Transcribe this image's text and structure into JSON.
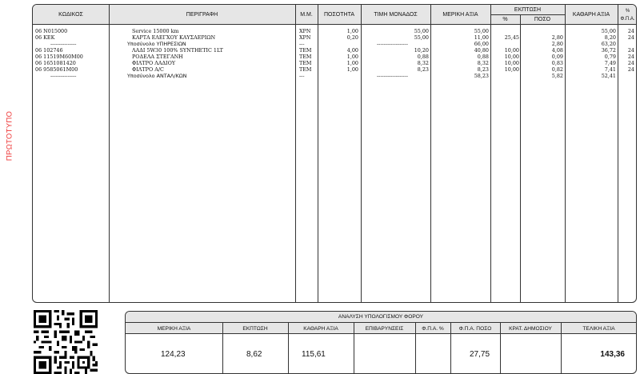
{
  "stamp_text": "ΠΡΩΤΟΤΥΠΟ",
  "columns": {
    "code": "ΚΩΔΙΚΟΣ",
    "description": "ΠΕΡΙΓΡΑΦΗ",
    "unit": "Μ.Μ.",
    "quantity": "ΠΟΣΟΤΗΤΑ",
    "unit_price": "ΤΙΜΗ ΜΟΝΑΔΟΣ",
    "partial_value": "ΜΕΡΙΚΗ ΑΞΙΑ",
    "discount": "ΕΚΠΤΩΣΗ",
    "discount_pct": "%",
    "discount_amount": "ΠΟΣΟ",
    "net_value": "ΚΑΘΑΡΗ ΑΞΙΑ",
    "vat_pct_top": "%",
    "vat_pct_bottom": "Φ.Π.Α."
  },
  "rows": [
    {
      "code": "06 N015000",
      "desc": "Service 15000 km",
      "unit": "ΧΡΝ",
      "qty": "1,00",
      "price": "55,00",
      "partial": "55,00",
      "disc_pct": "",
      "disc_amt": "",
      "net": "55,00",
      "vat": "24"
    },
    {
      "code": "06 ΚΕΚ",
      "desc": "ΚΑΡΤΑ ΕΛΕΓΧΟΥ ΚΑΥΣΑΕΡΙΩΝ",
      "unit": "ΧΡΝ",
      "qty": "0,20",
      "price": "55,00",
      "partial": "11,00",
      "disc_pct": "25,45",
      "disc_amt": "2,80",
      "net": "8,20",
      "vat": "24"
    },
    {
      "code": "---------------",
      "desc": "Υποσύνολο ΥΠΗΡΕΣΙΩΝ",
      "unit": "---",
      "qty": "",
      "price": "------------------",
      "partial": "66,00",
      "disc_pct": "",
      "disc_amt": "2,80",
      "net": "63,20",
      "vat": ""
    },
    {
      "code": "06 102746",
      "desc": "ΛΑΔΙ 5W30 100% SYNTHETIC 1LT",
      "unit": "ΤΕΜ",
      "qty": "4,00",
      "price": "10,20",
      "partial": "40,80",
      "disc_pct": "10,00",
      "disc_amt": "4,08",
      "net": "36,72",
      "vat": "24"
    },
    {
      "code": "06 11519M60M00",
      "desc": "ΡΟΔΕΛΑ ΣΤΕΓΑΝΗ",
      "unit": "ΤΕΜ",
      "qty": "1,00",
      "price": "0,88",
      "partial": "0,88",
      "disc_pct": "10,00",
      "disc_amt": "0,09",
      "net": "0,79",
      "vat": "24"
    },
    {
      "code": "06 1651081420",
      "desc": "ΦΙΛΤΡΟ ΛΑΔΙΟΥ",
      "unit": "ΤΕΜ",
      "qty": "1,00",
      "price": "8,32",
      "partial": "8,32",
      "disc_pct": "10,00",
      "disc_amt": "0,83",
      "net": "7,49",
      "vat": "24"
    },
    {
      "code": "06 9585061M00",
      "desc": "ΦΙΛΤΡΟ A/C",
      "unit": "ΤΕΜ",
      "qty": "1,00",
      "price": "8,23",
      "partial": "8,23",
      "disc_pct": "10,00",
      "disc_amt": "0,82",
      "net": "7,41",
      "vat": "24"
    },
    {
      "code": "---------------",
      "desc": "Υποσύνολο ΑΝΤΑΛ/ΚΩΝ",
      "unit": "---",
      "qty": "",
      "price": "------------------",
      "partial": "58,23",
      "disc_pct": "",
      "disc_amt": "5,82",
      "net": "52,41",
      "vat": ""
    }
  ],
  "tax": {
    "title": "ΑΝΑΛΥΣΗ ΥΠΟΛΟΓΙΣΜΟΥ ΦΟΡΟΥ",
    "headers": {
      "partial": "ΜΕΡΙΚΗ ΑΞΙΑ",
      "discount": "ΕΚΠΤΩΣΗ",
      "net": "ΚΑΘΑΡΗ ΑΞΙΑ",
      "surcharges": "ΕΠΙΒΑΡΥΝΣΕΙΣ",
      "vat_pct": "Φ.Π.Α. %",
      "vat_amount": "Φ.Π.Α. ΠΟΣΟ",
      "withholding": "ΚΡΑΤ. ΔΗΜΟΣΙΟΥ",
      "total": "ΤΕΛΙΚΗ ΑΞΙΑ"
    },
    "values": {
      "partial": "124,23",
      "discount": "8,62",
      "net": "115,61",
      "surcharges": "",
      "vat_pct": "",
      "vat_amount": "27,75",
      "withholding": "",
      "total": "143,36"
    }
  }
}
